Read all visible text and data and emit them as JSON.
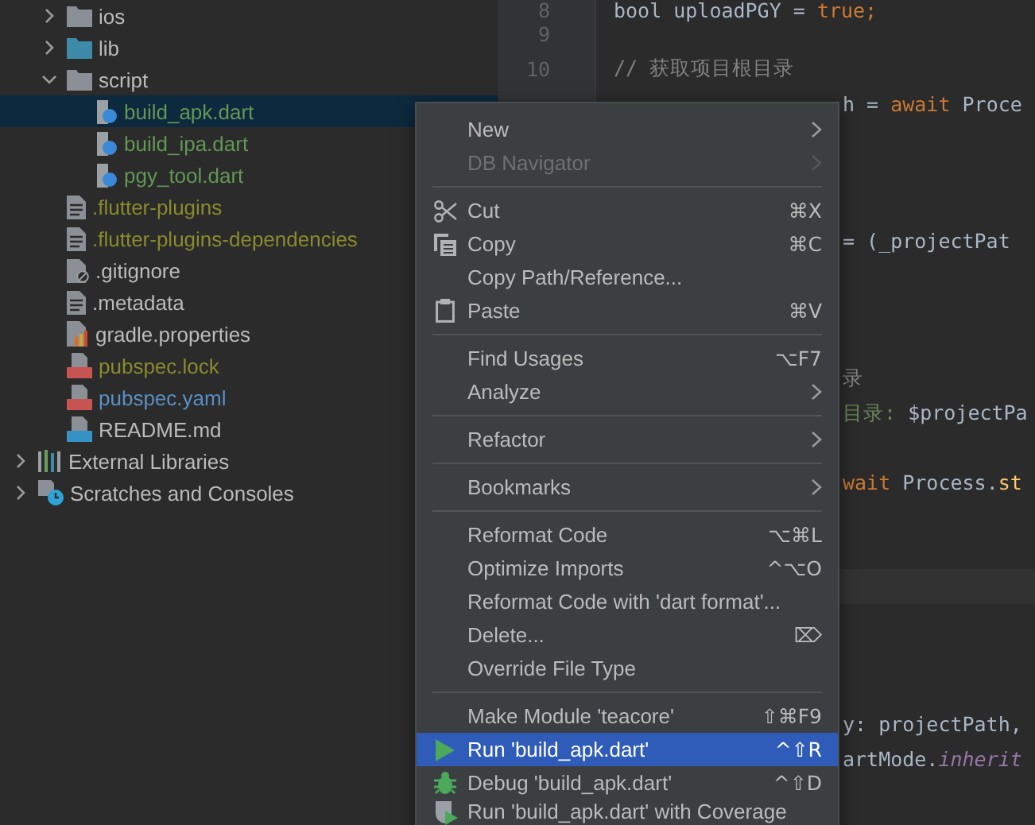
{
  "tree": [
    {
      "children": [
        {
          "label": "ios",
          "kind": "folder",
          "expanded": false,
          "selected": false,
          "color": "#bbbbbb"
        },
        {
          "label": "lib",
          "kind": "source-folder",
          "expanded": false,
          "selected": false,
          "color": "#bbbbbb"
        },
        {
          "label": "script",
          "kind": "folder",
          "expanded": true,
          "selected": false,
          "color": "#bbbbbb",
          "children": [
            {
              "label": "build_apk.dart",
              "kind": "dart",
              "selected": true,
              "color": "#629755"
            },
            {
              "label": "build_ipa.dart",
              "kind": "dart",
              "selected": false,
              "color": "#629755"
            },
            {
              "label": "pgy_tool.dart",
              "kind": "dart",
              "selected": false,
              "color": "#629755"
            }
          ]
        },
        {
          "label": ".flutter-plugins",
          "kind": "text",
          "selected": false,
          "color": "#8a8a2e"
        },
        {
          "label": ".flutter-plugins-dependencies",
          "kind": "text",
          "selected": false,
          "color": "#8a8a2e"
        },
        {
          "label": ".gitignore",
          "kind": "ignore",
          "selected": false,
          "color": "#bbbbbb"
        },
        {
          "label": ".metadata",
          "kind": "text",
          "selected": false,
          "color": "#bbbbbb"
        },
        {
          "label": "gradle.properties",
          "kind": "properties",
          "selected": false,
          "color": "#bbbbbb"
        },
        {
          "label": "pubspec.lock",
          "kind": "yaml",
          "selected": false,
          "color": "#8a8a2e"
        },
        {
          "label": "pubspec.yaml",
          "kind": "yaml",
          "selected": false,
          "color": "#5a8fc4"
        },
        {
          "label": "README.md",
          "kind": "markdown",
          "selected": false,
          "color": "#bbbbbb"
        }
      ]
    },
    {
      "label": "External Libraries",
      "kind": "libraries",
      "expanded": false,
      "selected": false,
      "color": "#bbbbbb"
    },
    {
      "label": "Scratches and Consoles",
      "kind": "scratches",
      "expanded": false,
      "selected": false,
      "color": "#bbbbbb"
    }
  ],
  "editor": {
    "lines": [
      {
        "kind": "code",
        "number": "8",
        "tokens": [
          {
            "kind": "plain",
            "text": "bool uploadPGY = "
          },
          {
            "kind": "keyword",
            "text": "true;"
          }
        ]
      },
      {
        "kind": "code",
        "number": "9"
      },
      {
        "kind": "code",
        "number": "10",
        "tokens": [
          {
            "kind": "comment",
            "text": "// 获取项目根目录"
          }
        ]
      },
      {
        "kind": "fragment",
        "tokens": [
          {
            "kind": "plain",
            "text": "h = "
          },
          {
            "kind": "keyword",
            "text": "await"
          },
          {
            "kind": "plain",
            "text": " Proce"
          }
        ]
      },
      {
        "kind": "blank"
      },
      {
        "kind": "blank"
      },
      {
        "kind": "blank"
      },
      {
        "kind": "fragment",
        "tokens": [
          {
            "kind": "plain",
            "text": "= (_projectPat"
          }
        ]
      },
      {
        "kind": "blank"
      },
      {
        "kind": "blank"
      },
      {
        "kind": "blank"
      },
      {
        "kind": "fragment",
        "tokens": [
          {
            "kind": "comment",
            "text": "录"
          }
        ]
      },
      {
        "kind": "fragment",
        "tokens": [
          {
            "kind": "string",
            "text": "目录: "
          },
          {
            "kind": "plain",
            "text": "$projectPa"
          }
        ]
      },
      {
        "kind": "blank"
      },
      {
        "kind": "fragment",
        "tokens": [
          {
            "kind": "keyword",
            "text": "wait"
          },
          {
            "kind": "plain",
            "text": " Process."
          },
          {
            "kind": "method",
            "text": "st"
          }
        ]
      },
      {
        "kind": "blank"
      },
      {
        "kind": "blank"
      },
      {
        "kind": "blank",
        "current": true
      },
      {
        "kind": "blank"
      },
      {
        "kind": "blank"
      },
      {
        "kind": "blank"
      },
      {
        "kind": "fragment",
        "tokens": [
          {
            "kind": "plain",
            "text": "y: projectPath,"
          }
        ]
      },
      {
        "kind": "fragment",
        "tokens": [
          {
            "kind": "plain",
            "text": "artMode."
          },
          {
            "kind": "field",
            "text": "inherit"
          }
        ]
      }
    ]
  },
  "context_menu": {
    "groups": [
      [
        {
          "label": "New",
          "submenu": true,
          "disabled": false,
          "selected": false
        },
        {
          "label": "DB Navigator",
          "submenu": true,
          "disabled": true,
          "selected": false
        }
      ],
      [
        {
          "label": "Cut",
          "kind": "cut",
          "shortcut": "⌘X",
          "disabled": false,
          "selected": false
        },
        {
          "label": "Copy",
          "kind": "copy",
          "shortcut": "⌘C",
          "disabled": false,
          "selected": false
        },
        {
          "label": "Copy Path/Reference...",
          "disabled": false,
          "selected": false
        },
        {
          "label": "Paste",
          "kind": "paste",
          "shortcut": "⌘V",
          "disabled": false,
          "selected": false
        }
      ],
      [
        {
          "label": "Find Usages",
          "shortcut": "⌥F7",
          "disabled": false,
          "selected": false
        },
        {
          "label": "Analyze",
          "submenu": true,
          "disabled": false,
          "selected": false
        }
      ],
      [
        {
          "label": "Refactor",
          "submenu": true,
          "disabled": false,
          "selected": false
        }
      ],
      [
        {
          "label": "Bookmarks",
          "submenu": true,
          "disabled": false,
          "selected": false
        }
      ],
      [
        {
          "label": "Reformat Code",
          "shortcut": "⌥⌘L",
          "disabled": false,
          "selected": false
        },
        {
          "label": "Optimize Imports",
          "shortcut": "^⌥O",
          "disabled": false,
          "selected": false
        },
        {
          "label": "Reformat Code with 'dart format'...",
          "disabled": false,
          "selected": false
        },
        {
          "label": "Delete...",
          "shortcut": "⌦",
          "disabled": false,
          "selected": false
        },
        {
          "label": "Override File Type",
          "disabled": false,
          "selected": false
        }
      ],
      [
        {
          "label": "Make Module 'teacore'",
          "shortcut": "⇧⌘F9",
          "disabled": false,
          "selected": false
        },
        {
          "label": "Run 'build_apk.dart'",
          "kind": "run",
          "shortcut": "^⇧R",
          "disabled": false,
          "selected": true
        },
        {
          "label": "Debug 'build_apk.dart'",
          "kind": "debug",
          "shortcut": "^⇧D",
          "disabled": false,
          "selected": false
        },
        {
          "label": "Run 'build_apk.dart' with Coverage",
          "kind": "coverage",
          "disabled": false,
          "selected": false
        }
      ]
    ]
  }
}
